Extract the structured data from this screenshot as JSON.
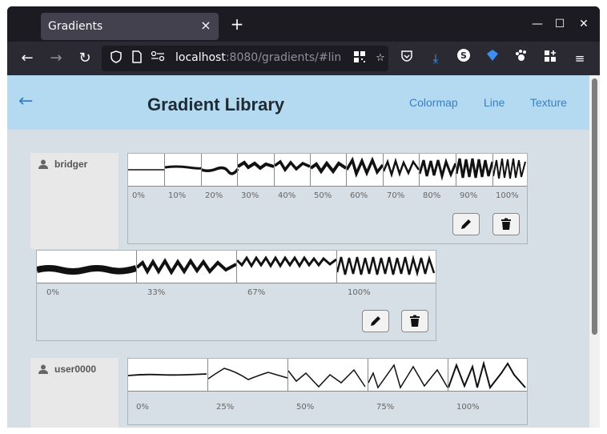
{
  "browser": {
    "tab_title": "Gradients",
    "tab_close": "×",
    "new_tab": "+",
    "url_host": "localhost",
    "url_rest": ":8080/gradients/#lin",
    "icons": [
      "back-icon",
      "forward-icon",
      "reload-icon",
      "shield-icon",
      "page-icon",
      "permissions-icon",
      "qr-icon",
      "bookmark-star-icon",
      "pocket-icon",
      "downloads-icon",
      "extension-s-icon",
      "extension-blue-icon",
      "extension-paw-icon",
      "extensions-puzzle-icon",
      "menu-icon"
    ]
  },
  "header": {
    "back_arrow": "←",
    "title": "Gradient Library",
    "links": [
      "Colormap",
      "Line",
      "Texture"
    ]
  },
  "users": [
    {
      "name": "bridger"
    },
    {
      "name": "user0000"
    }
  ],
  "gradients": [
    {
      "ticks": [
        "0%",
        "10%",
        "20%",
        "30%",
        "40%",
        "50%",
        "60%",
        "70%",
        "80%",
        "90%",
        "100%"
      ]
    },
    {
      "ticks": [
        "0%",
        "33%",
        "67%",
        "100%"
      ]
    },
    {
      "ticks": [
        "0%",
        "25%",
        "50%",
        "75%",
        "100%"
      ]
    }
  ],
  "colors": {
    "header_bg": "#b3daf1",
    "content_bg": "#d6dfe6",
    "accent": "#3a7fc1"
  }
}
